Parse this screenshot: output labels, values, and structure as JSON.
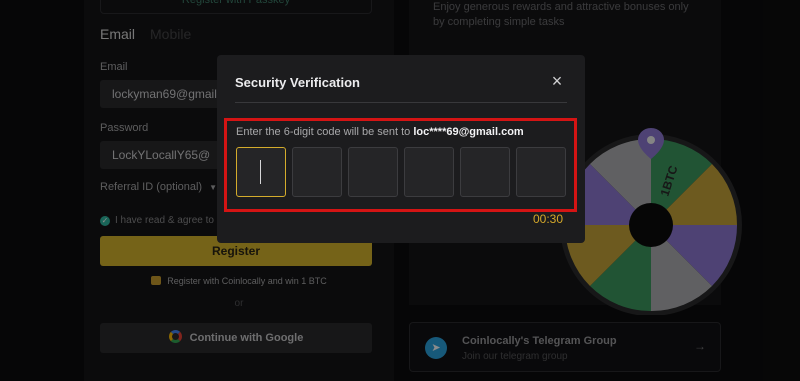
{
  "register": {
    "top_button_label": "Register with Passkey",
    "tabs": [
      "Email",
      "Mobile"
    ],
    "email_label": "Email",
    "email_value": "lockyman69@gmail.com",
    "password_label": "Password",
    "password_value": "LockYLocallY65@",
    "referral_label": "Referral ID (optional)",
    "terms_text": "I have read & agree to",
    "register_button": "Register",
    "promo_text": "Register with Coinlocally and win 1 BTC",
    "or_text": "or",
    "google_button": "Continue with Google"
  },
  "promo_panel": {
    "text": "Enjoy generous rewards and attractive bonuses only by completing simple tasks",
    "wheel_label": "1BTC",
    "wheel_colors": [
      "#8e79d3",
      "#3d9a5f",
      "#c6a43a",
      "#b0b0b2"
    ]
  },
  "telegram": {
    "title": "Coinlocally's Telegram Group",
    "subtitle": "Join our telegram group",
    "arrow": "→"
  },
  "modal": {
    "title": "Security Verification",
    "close_icon": "×",
    "instruction": "Enter the 6-digit code will be sent to ",
    "email": "loc****69@gmail.com",
    "code_boxes": 6,
    "timer": "00:30"
  },
  "colors": {
    "accent": "#d6b42d",
    "highlight": "#d41414",
    "timer": "#d4a82a"
  }
}
